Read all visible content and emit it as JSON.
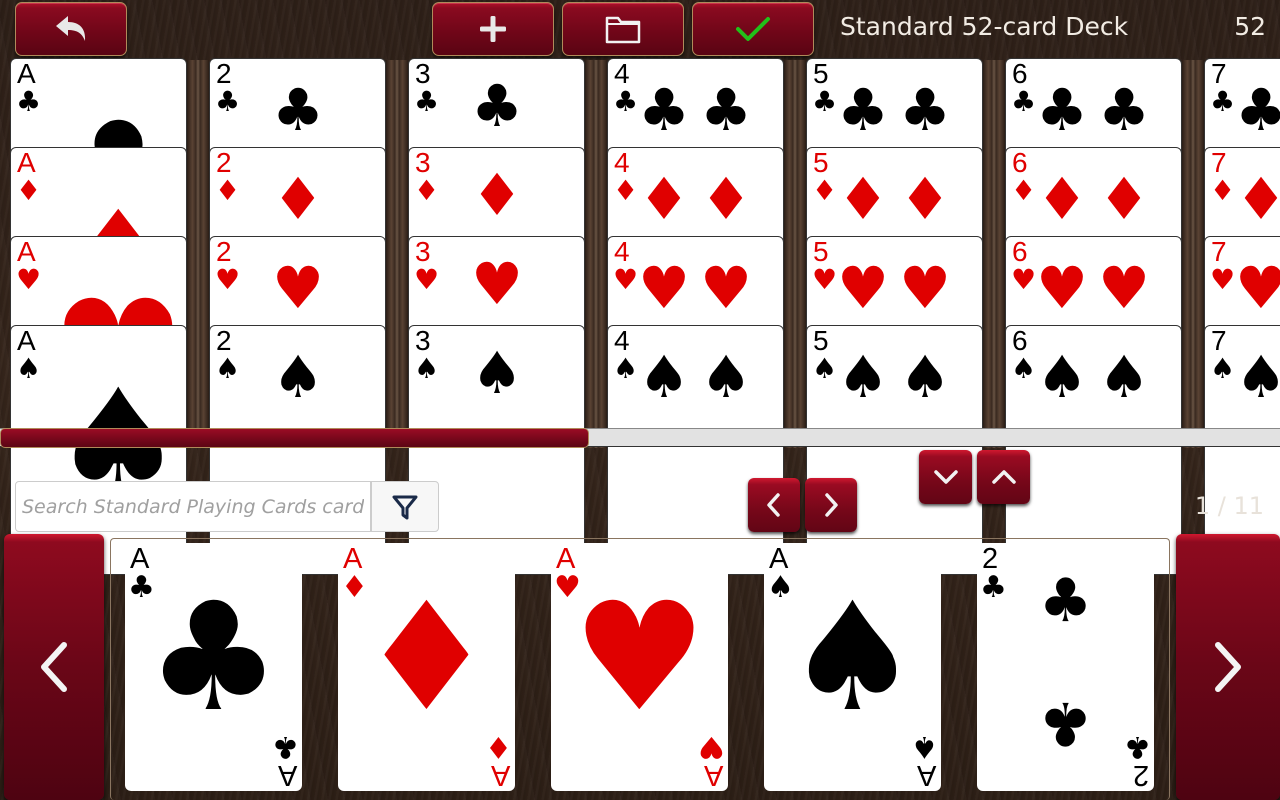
{
  "toolbar": {
    "back_icon": "undo-arrow-icon",
    "add_icon": "plus-icon",
    "folder_icon": "folder-icon",
    "confirm_icon": "checkmark-icon",
    "confirm_color": "#22c01a",
    "deck_title": "Standard 52-card Deck",
    "card_count": "52"
  },
  "deck_grid": {
    "columns": [
      {
        "rank": "A",
        "cards": [
          {
            "suit": "♣",
            "color": "black"
          },
          {
            "suit": "♦",
            "color": "red"
          },
          {
            "suit": "♥",
            "color": "red"
          },
          {
            "suit": "♠",
            "color": "black"
          }
        ]
      },
      {
        "rank": "2",
        "cards": [
          {
            "suit": "♣",
            "color": "black"
          },
          {
            "suit": "♦",
            "color": "red"
          },
          {
            "suit": "♥",
            "color": "red"
          },
          {
            "suit": "♠",
            "color": "black"
          }
        ]
      },
      {
        "rank": "3",
        "cards": [
          {
            "suit": "♣",
            "color": "black"
          },
          {
            "suit": "♦",
            "color": "red"
          },
          {
            "suit": "♥",
            "color": "red"
          },
          {
            "suit": "♠",
            "color": "black"
          }
        ]
      },
      {
        "rank": "4",
        "cards": [
          {
            "suit": "♣",
            "color": "black"
          },
          {
            "suit": "♦",
            "color": "red"
          },
          {
            "suit": "♥",
            "color": "red"
          },
          {
            "suit": "♠",
            "color": "black"
          }
        ]
      },
      {
        "rank": "5",
        "cards": [
          {
            "suit": "♣",
            "color": "black"
          },
          {
            "suit": "♦",
            "color": "red"
          },
          {
            "suit": "♥",
            "color": "red"
          },
          {
            "suit": "♠",
            "color": "black"
          }
        ]
      },
      {
        "rank": "6",
        "cards": [
          {
            "suit": "♣",
            "color": "black"
          },
          {
            "suit": "♦",
            "color": "red"
          },
          {
            "suit": "♥",
            "color": "red"
          },
          {
            "suit": "♠",
            "color": "black"
          }
        ]
      },
      {
        "rank": "7",
        "cards": [
          {
            "suit": "♣",
            "color": "black"
          },
          {
            "suit": "♦",
            "color": "red"
          },
          {
            "suit": "♥",
            "color": "red"
          },
          {
            "suit": "♠",
            "color": "black"
          }
        ]
      }
    ],
    "scroll_position_fraction": 0.46
  },
  "controls": {
    "collapse_icon": "chevron-down-icon",
    "expand_icon": "chevron-up-icon",
    "prev_icon": "chevron-left-icon",
    "next_icon": "chevron-right-icon"
  },
  "search": {
    "placeholder": "Search Standard Playing Cards cards",
    "value": "",
    "filter_icon": "filter-icon"
  },
  "pagination": {
    "current": 1,
    "total": 11,
    "label": "1 / 11"
  },
  "card_tray": {
    "cards": [
      {
        "rank": "A",
        "suit": "♣",
        "color": "black",
        "name": "Ace of Clubs"
      },
      {
        "rank": "A",
        "suit": "♦",
        "color": "red",
        "name": "Ace of Diamonds"
      },
      {
        "rank": "A",
        "suit": "♥",
        "color": "red",
        "name": "Ace of Hearts"
      },
      {
        "rank": "A",
        "suit": "♠",
        "color": "black",
        "name": "Ace of Spades"
      },
      {
        "rank": "2",
        "suit": "♣",
        "color": "black",
        "name": "Two of Clubs"
      }
    ]
  },
  "colors": {
    "accent_red": "#8a0a20",
    "suit_red": "#e00000",
    "suit_black": "#000000",
    "text_light": "#f2ece4"
  }
}
